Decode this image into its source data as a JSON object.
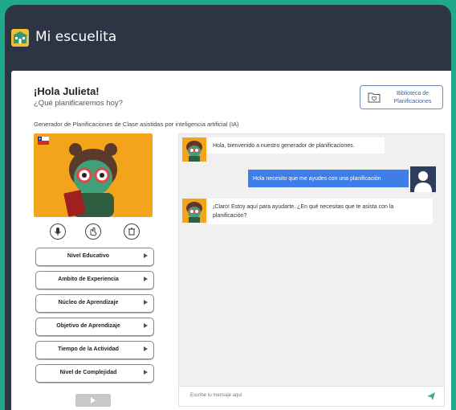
{
  "app": {
    "title": "Mi escuelita"
  },
  "header": {
    "greeting": "¡Hola Julieta!",
    "question": "¿Qué planificaremos hoy?",
    "library_button": {
      "line1": "Biblioteca de",
      "line2": "Planificaciones"
    }
  },
  "subtitle": "Generador de Planificaciones de Clase asistidas por inteligencia artificial (IA)",
  "menu": [
    {
      "label": "Nivel Educativo"
    },
    {
      "label": "Ambito de Experiencia"
    },
    {
      "label": "Núcleo de Aprendizaje"
    },
    {
      "label": "Objetivo de Aprendizaje"
    },
    {
      "label": "Tiempo de la Actividad"
    },
    {
      "label": "Nivel de Complejidad"
    }
  ],
  "chat": {
    "messages": [
      {
        "from": "bot",
        "text": "Hola, bienvenido a nuestro generador de planificaciones."
      },
      {
        "from": "user",
        "text": "Hola necesito que me ayudes con una planificación"
      },
      {
        "from": "bot",
        "text": "¡Claro! Estoy aquí para ayudarte. ¿En qué necesitas que te asista con la planificación?"
      }
    ],
    "input_placeholder": "Escribe tu mensaje aquí"
  },
  "icons": {
    "logo": "school-logo-icon",
    "folder": "folder-heart-icon",
    "flag": "chile-flag-icon",
    "tools": [
      "microphone-icon",
      "sign-language-icon",
      "trash-icon"
    ],
    "send": "send-icon"
  },
  "colors": {
    "background": "#1fa98a",
    "topbar": "#2d3444",
    "avatar_bg": "#f4a41a",
    "user_bubble": "#3f7de8",
    "send": "#36b37e"
  }
}
